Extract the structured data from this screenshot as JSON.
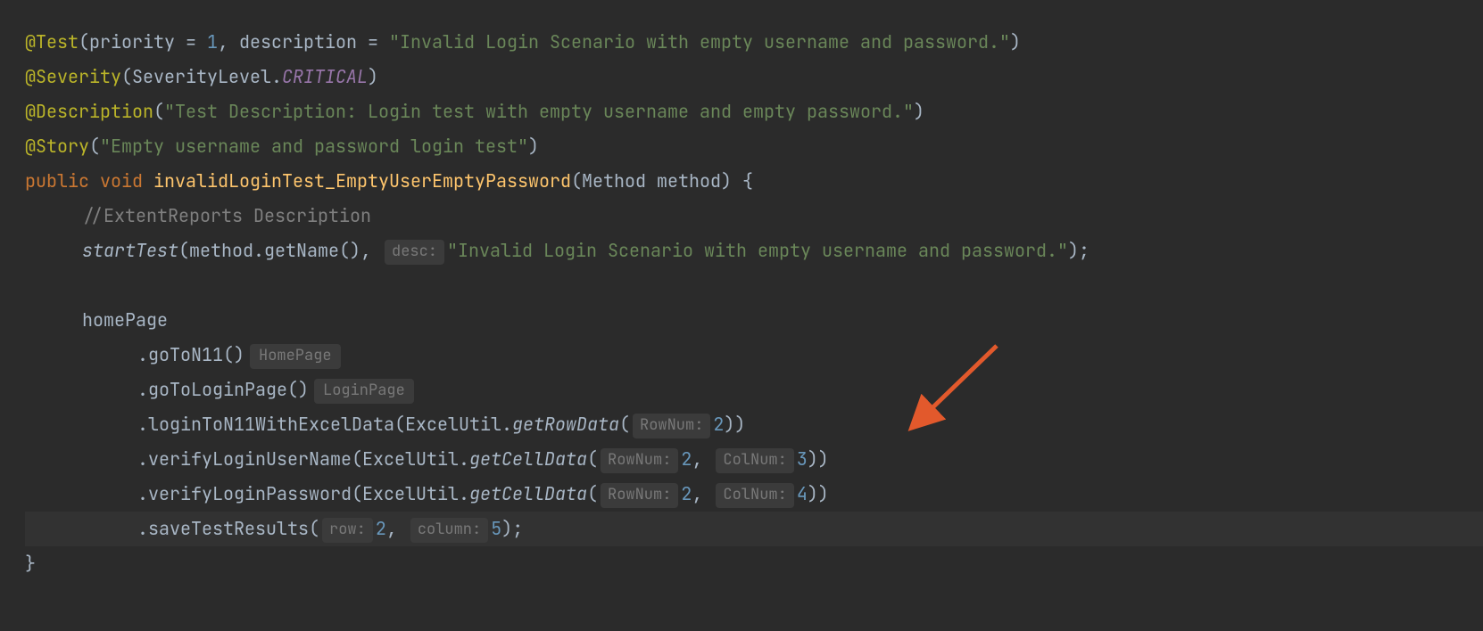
{
  "l1": {
    "anno": "@Test",
    "p_priority": "priority",
    "eq1": " = ",
    "n_priority": "1",
    "comma": ", ",
    "p_description": "description",
    "eq2": " = ",
    "str": "\"Invalid Login Scenario with empty username and password.\"",
    "close": ")"
  },
  "l2": {
    "anno": "@Severity",
    "open": "(",
    "cls": "SeverityLevel",
    "dot": ".",
    "const": "CRITICAL",
    "close": ")"
  },
  "l3": {
    "anno": "@Description",
    "open": "(",
    "str": "\"Test Description: Login test with empty username and empty password.\"",
    "close": ")"
  },
  "l4": {
    "anno": "@Story",
    "open": "(",
    "str": "\"Empty username and password login test\"",
    "close": ")"
  },
  "l5": {
    "kw": "public void",
    "sp": " ",
    "mname": "invalidLoginTest_EmptyUserEmptyPassword",
    "sig": "(Method method) {"
  },
  "l6": {
    "cmt": "//ExtentReports Description"
  },
  "l7": {
    "fn": "startTest",
    "args_a": "(method.getName(), ",
    "hint": "desc:",
    "str": "\"Invalid Login Scenario with empty username and password.\"",
    "close": ");"
  },
  "l9": {
    "txt": "homePage"
  },
  "l10": {
    "dot": ".",
    "m": "goToN11",
    "par": "()",
    "hint": "HomePage"
  },
  "l11": {
    "dot": ".",
    "m": "goToLoginPage",
    "par": "()",
    "hint": "LoginPage"
  },
  "l12": {
    "dot": ".",
    "m": "loginToN11WithExcelData",
    "open": "(ExcelUtil.",
    "sm": "getRowData",
    "p1_open": "(",
    "hint1": "RowNum:",
    "n1": "2",
    "close": "))"
  },
  "l13": {
    "dot": ".",
    "m": "verifyLoginUserName",
    "open": "(ExcelUtil.",
    "sm": "getCellData",
    "p1_open": "(",
    "hint1": "RowNum:",
    "n1": "2",
    "comma": ", ",
    "hint2": "ColNum:",
    "n2": "3",
    "close": "))"
  },
  "l14": {
    "dot": ".",
    "m": "verifyLoginPassword",
    "open": "(ExcelUtil.",
    "sm": "getCellData",
    "p1_open": "(",
    "hint1": "RowNum:",
    "n1": "2",
    "comma": ", ",
    "hint2": "ColNum:",
    "n2": "4",
    "close": "))"
  },
  "l15": {
    "dot": ".",
    "m": "saveTestResults",
    "open": "(",
    "hint1": "row:",
    "n1": "2",
    "comma": ", ",
    "hint2": "column:",
    "n2": "5",
    "close": ");"
  },
  "l16": {
    "brace": "}"
  }
}
